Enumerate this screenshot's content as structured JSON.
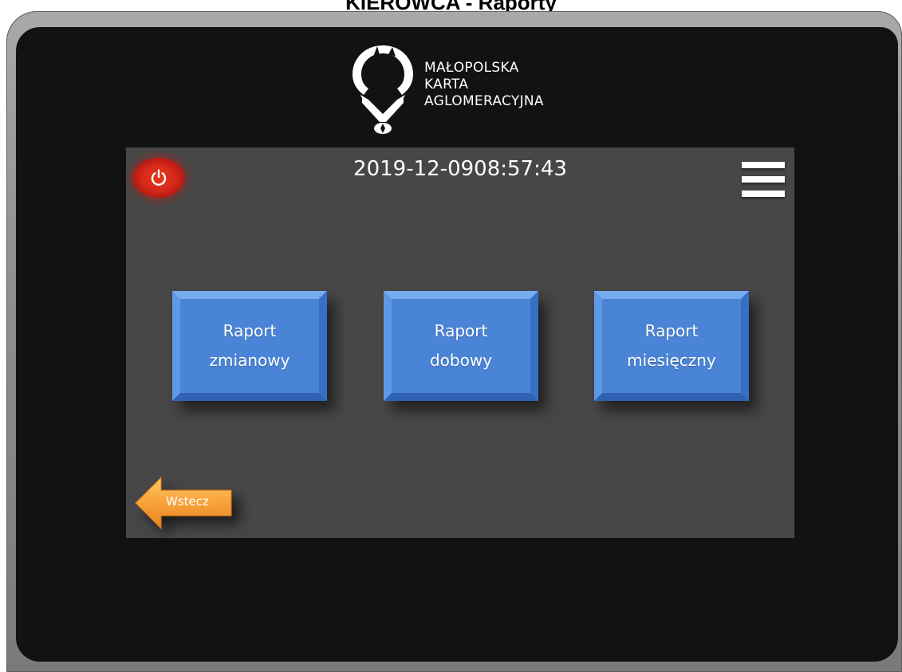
{
  "page": {
    "title": "KIEROWCA - Raporty"
  },
  "logo": {
    "line1": "MAŁOPOLSKA",
    "line2": "KARTA",
    "line3": "AGLOMERACYJNA"
  },
  "header": {
    "date": "2019-12-09",
    "time": "08:57:43",
    "power_icon": "power-icon",
    "menu_icon": "hamburger-menu-icon"
  },
  "reports": [
    {
      "line1": "Raport",
      "line2": "zmianowy"
    },
    {
      "line1": "Raport",
      "line2": "dobowy"
    },
    {
      "line1": "Raport",
      "line2": "miesięczny"
    }
  ],
  "back": {
    "label": "Wstecz",
    "icon": "arrow-left-icon"
  },
  "colors": {
    "report_button": "#4a84d6",
    "display_background": "#474747",
    "bezel": "#121212",
    "power_button": "#d6291a",
    "back_arrow": "#f7a23a"
  }
}
